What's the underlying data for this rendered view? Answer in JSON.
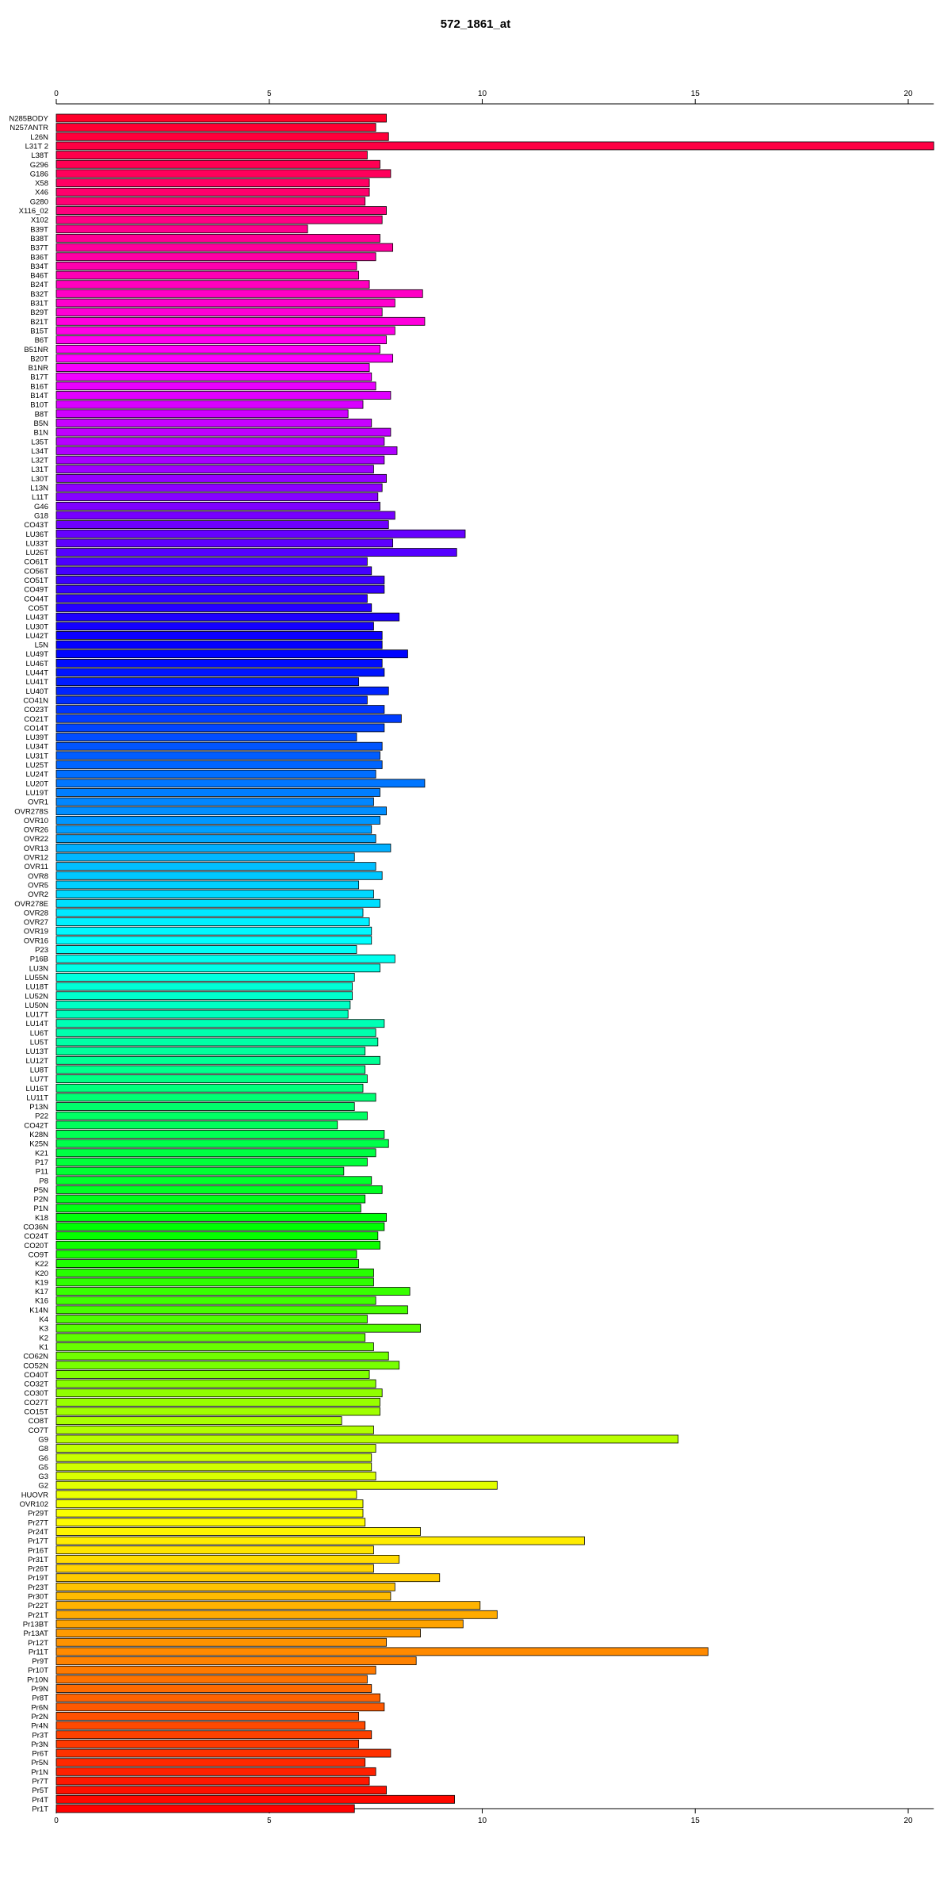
{
  "chart_data": {
    "type": "bar",
    "orientation": "horizontal",
    "title": "572_1861_at",
    "xlabel": "",
    "ylabel": "",
    "xlim": [
      0,
      20.6
    ],
    "xticks": [
      0,
      5,
      10,
      15,
      20
    ],
    "axis_positions": [
      "top",
      "bottom"
    ],
    "grid": false,
    "legend": "none",
    "color_scheme": "rainbow",
    "categories": [
      "N285BODY",
      "N257ANTR",
      "L26N",
      "L31T 2",
      "L38T",
      "G296",
      "G186",
      "X58",
      "X46",
      "G280",
      "X116_02",
      "X102",
      "B39T",
      "B38T",
      "B37T",
      "B36T",
      "B34T",
      "B46T",
      "B24T",
      "B32T",
      "B31T",
      "B29T",
      "B21T",
      "B15T",
      "B6T",
      "B51NR",
      "B20T",
      "B1NR",
      "B17T",
      "B16T",
      "B14T",
      "B10T",
      "B8T",
      "B5N",
      "B1N",
      "L35T",
      "L34T",
      "L32T",
      "L31T",
      "L30T",
      "L13N",
      "L11T",
      "G46",
      "G18",
      "CO43T",
      "LU36T",
      "LU33T",
      "LU26T",
      "CO61T",
      "CO56T",
      "CO51T",
      "CO49T",
      "CO44T",
      "CO5T",
      "LU43T",
      "LU30T",
      "LU42T",
      "L5N",
      "LU49T",
      "LU46T",
      "LU44T",
      "LU41T",
      "LU40T",
      "CO41N",
      "CO23T",
      "CO21T",
      "CO14T",
      "LU39T",
      "LU34T",
      "LU31T",
      "LU25T",
      "LU24T",
      "LU20T",
      "LU19T",
      "OVR1",
      "OVR278S",
      "OVR10",
      "OVR26",
      "OVR22",
      "OVR13",
      "OVR12",
      "OVR11",
      "OVR8",
      "OVR5",
      "OVR2",
      "OVR278E",
      "OVR28",
      "OVR27",
      "OVR19",
      "OVR16",
      "P23",
      "P16B",
      "LU3N",
      "LU55N",
      "LU18T",
      "LU52N",
      "LU50N",
      "LU17T",
      "LU14T",
      "LU6T",
      "LU5T",
      "LU13T",
      "LU12T",
      "LU8T",
      "LU7T",
      "LU16T",
      "LU11T",
      "P13N",
      "P22",
      "CO42T",
      "K28N",
      "K25N",
      "K21",
      "P17",
      "P11",
      "P8",
      "P5N",
      "P2N",
      "P1N",
      "K18",
      "CO36N",
      "CO24T",
      "CO20T",
      "CO9T",
      "K22",
      "K20",
      "K19",
      "K17",
      "K16",
      "K14N",
      "K4",
      "K3",
      "K2",
      "K1",
      "CO62N",
      "CO52N",
      "CO40T",
      "CO32T",
      "CO30T",
      "CO27T",
      "CO15T",
      "CO8T",
      "CO7T",
      "G9",
      "G8",
      "G6",
      "G5",
      "G3",
      "G2",
      "HUOVR",
      "OVR102",
      "Pr29T",
      "Pr27T",
      "Pr24T",
      "Pr17T",
      "Pr16T",
      "Pr31T",
      "Pr26T",
      "Pr19T",
      "Pr23T",
      "Pr30T",
      "Pr22T",
      "Pr21T",
      "Pr13BT",
      "Pr13AT",
      "Pr12T",
      "Pr11T",
      "Pr9T",
      "Pr10T",
      "Pr10N",
      "Pr9N",
      "Pr8T",
      "Pr6N",
      "Pr2N",
      "Pr4N",
      "Pr3T",
      "Pr3N",
      "Pr6T",
      "Pr5N",
      "Pr1N",
      "Pr7T",
      "Pr5T",
      "Pr4T",
      "Pr1T"
    ],
    "values": [
      7.75,
      7.5,
      7.8,
      20.6,
      7.3,
      7.6,
      7.85,
      7.35,
      7.35,
      7.25,
      7.75,
      7.65,
      5.9,
      7.6,
      7.9,
      7.5,
      7.05,
      7.1,
      7.35,
      8.6,
      7.95,
      7.65,
      8.65,
      7.95,
      7.75,
      7.6,
      7.9,
      7.35,
      7.4,
      7.5,
      7.85,
      7.2,
      6.85,
      7.4,
      7.85,
      7.7,
      8.0,
      7.7,
      7.45,
      7.75,
      7.65,
      7.55,
      7.6,
      7.95,
      7.8,
      9.6,
      7.9,
      9.4,
      7.3,
      7.4,
      7.7,
      7.7,
      7.3,
      7.4,
      8.05,
      7.45,
      7.65,
      7.65,
      8.25,
      7.65,
      7.7,
      7.1,
      7.8,
      7.3,
      7.7,
      8.1,
      7.7,
      7.05,
      7.65,
      7.6,
      7.65,
      7.5,
      8.65,
      7.6,
      7.45,
      7.75,
      7.6,
      7.4,
      7.5,
      7.85,
      7.0,
      7.5,
      7.65,
      7.1,
      7.45,
      7.6,
      7.2,
      7.35,
      7.4,
      7.4,
      7.05,
      7.95,
      7.6,
      7.0,
      6.95,
      6.95,
      6.9,
      6.85,
      7.7,
      7.5,
      7.55,
      7.25,
      7.6,
      7.25,
      7.3,
      7.2,
      7.5,
      7.0,
      7.3,
      6.6,
      7.7,
      7.8,
      7.5,
      7.3,
      6.75,
      7.4,
      7.65,
      7.25,
      7.15,
      7.75,
      7.7,
      7.55,
      7.6,
      7.05,
      7.1,
      7.45,
      7.45,
      8.3,
      7.5,
      8.25,
      7.3,
      8.55,
      7.25,
      7.45,
      7.8,
      8.05,
      7.35,
      7.5,
      7.65,
      7.6,
      7.6,
      6.7,
      7.45,
      14.6,
      7.5,
      7.4,
      7.4,
      7.5,
      10.35,
      7.05,
      7.2,
      7.2,
      7.25,
      8.55,
      12.4,
      7.45,
      8.05,
      7.45,
      9.0,
      7.95,
      7.85,
      9.95,
      10.35,
      9.55,
      8.55,
      7.75,
      15.3,
      8.45,
      7.5,
      7.3,
      7.4,
      7.6,
      7.7,
      7.1,
      7.25,
      7.4,
      7.1,
      7.85,
      7.25,
      7.5,
      7.35,
      7.75,
      9.35,
      7.0
    ]
  }
}
